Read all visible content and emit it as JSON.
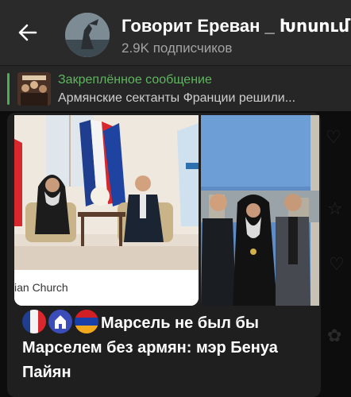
{
  "header": {
    "channel_title": "Говорит Ереван _ Խոսում",
    "subscribers": "2.9K подписчиков"
  },
  "pinned": {
    "label": "Закреплённое сообщение",
    "text": "Армянские сектанты Франции решили..."
  },
  "post": {
    "photo_caption": "ian Church",
    "text": "Марсель не был бы Марселем без армян: мэр Бенуа Пайян"
  },
  "colors": {
    "header_bg": "#2a2a2a",
    "pinned_accent": "#4caf50",
    "bubble_bg": "#1f1f1f"
  }
}
